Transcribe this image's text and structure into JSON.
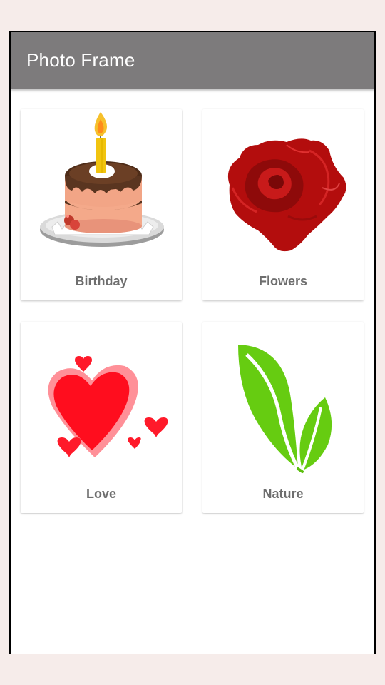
{
  "app": {
    "title": "Photo Frame"
  },
  "categories": [
    {
      "label": "Birthday",
      "icon": "birthday-cake-icon"
    },
    {
      "label": "Flowers",
      "icon": "red-rose-icon"
    },
    {
      "label": "Love",
      "icon": "hearts-icon"
    },
    {
      "label": "Nature",
      "icon": "green-leaves-icon"
    }
  ],
  "colors": {
    "appbar": "#7d7b7c",
    "label_text": "#6e6e6e",
    "background": "#ffffff"
  }
}
